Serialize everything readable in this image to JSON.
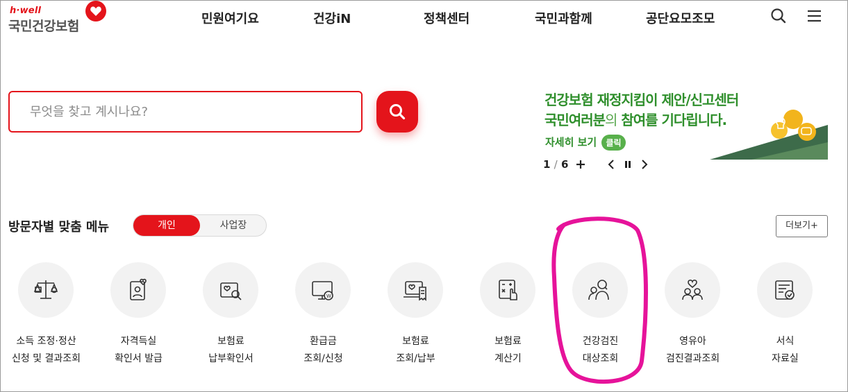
{
  "header": {
    "logo_small": "h·well",
    "logo_main": "국민건강보험",
    "nav": [
      "민원여기요",
      "건강iN",
      "정책센터",
      "국민과함께",
      "공단요모조모"
    ],
    "search_icon": "search-icon",
    "menu_icon": "hamburger-menu-icon"
  },
  "search": {
    "placeholder": "무엇을 찾고 계시나요?",
    "value": ""
  },
  "banner": {
    "line1": "건강보험 재정지킴이 제안/신고센터",
    "line2_emph": "국민여러분",
    "line2_soft": "의",
    "line2_rest": " 참여를 기다립니다.",
    "more_label": "자세히 보기",
    "click_badge": "클릭",
    "pager_current": "1",
    "pager_total": "6"
  },
  "visitor_menu": {
    "title": "방문자별 맞춤 메뉴",
    "tabs": [
      "개인",
      "사업장"
    ],
    "active_tab": "개인",
    "more_label": "더보기+",
    "items": [
      {
        "line1": "소득 조정·정산",
        "line2": "신청 및 결과조회",
        "icon": "scale-icon"
      },
      {
        "line1": "자격득실",
        "line2": "확인서 발급",
        "icon": "id-card-heart-icon"
      },
      {
        "line1": "보험료",
        "line2": "납부확인서",
        "icon": "document-search-icon"
      },
      {
        "line1": "환급금",
        "line2": "조회/신청",
        "icon": "monitor-coin-icon"
      },
      {
        "line1": "보험료",
        "line2": "조회/납부",
        "icon": "laptop-receipt-icon"
      },
      {
        "line1": "보험료",
        "line2": "계산기",
        "icon": "calculator-hand-icon"
      },
      {
        "line1": "건강검진",
        "line2": "대상조회",
        "icon": "people-search-icon"
      },
      {
        "line1": "영유아",
        "line2": "검진결과조회",
        "icon": "parent-child-heart-icon"
      },
      {
        "line1": "서식",
        "line2": "자료실",
        "icon": "form-check-icon"
      }
    ]
  },
  "colors": {
    "accent": "#e4141b",
    "banner_green": "#2f8f2c",
    "annotation": "#e6139a"
  }
}
